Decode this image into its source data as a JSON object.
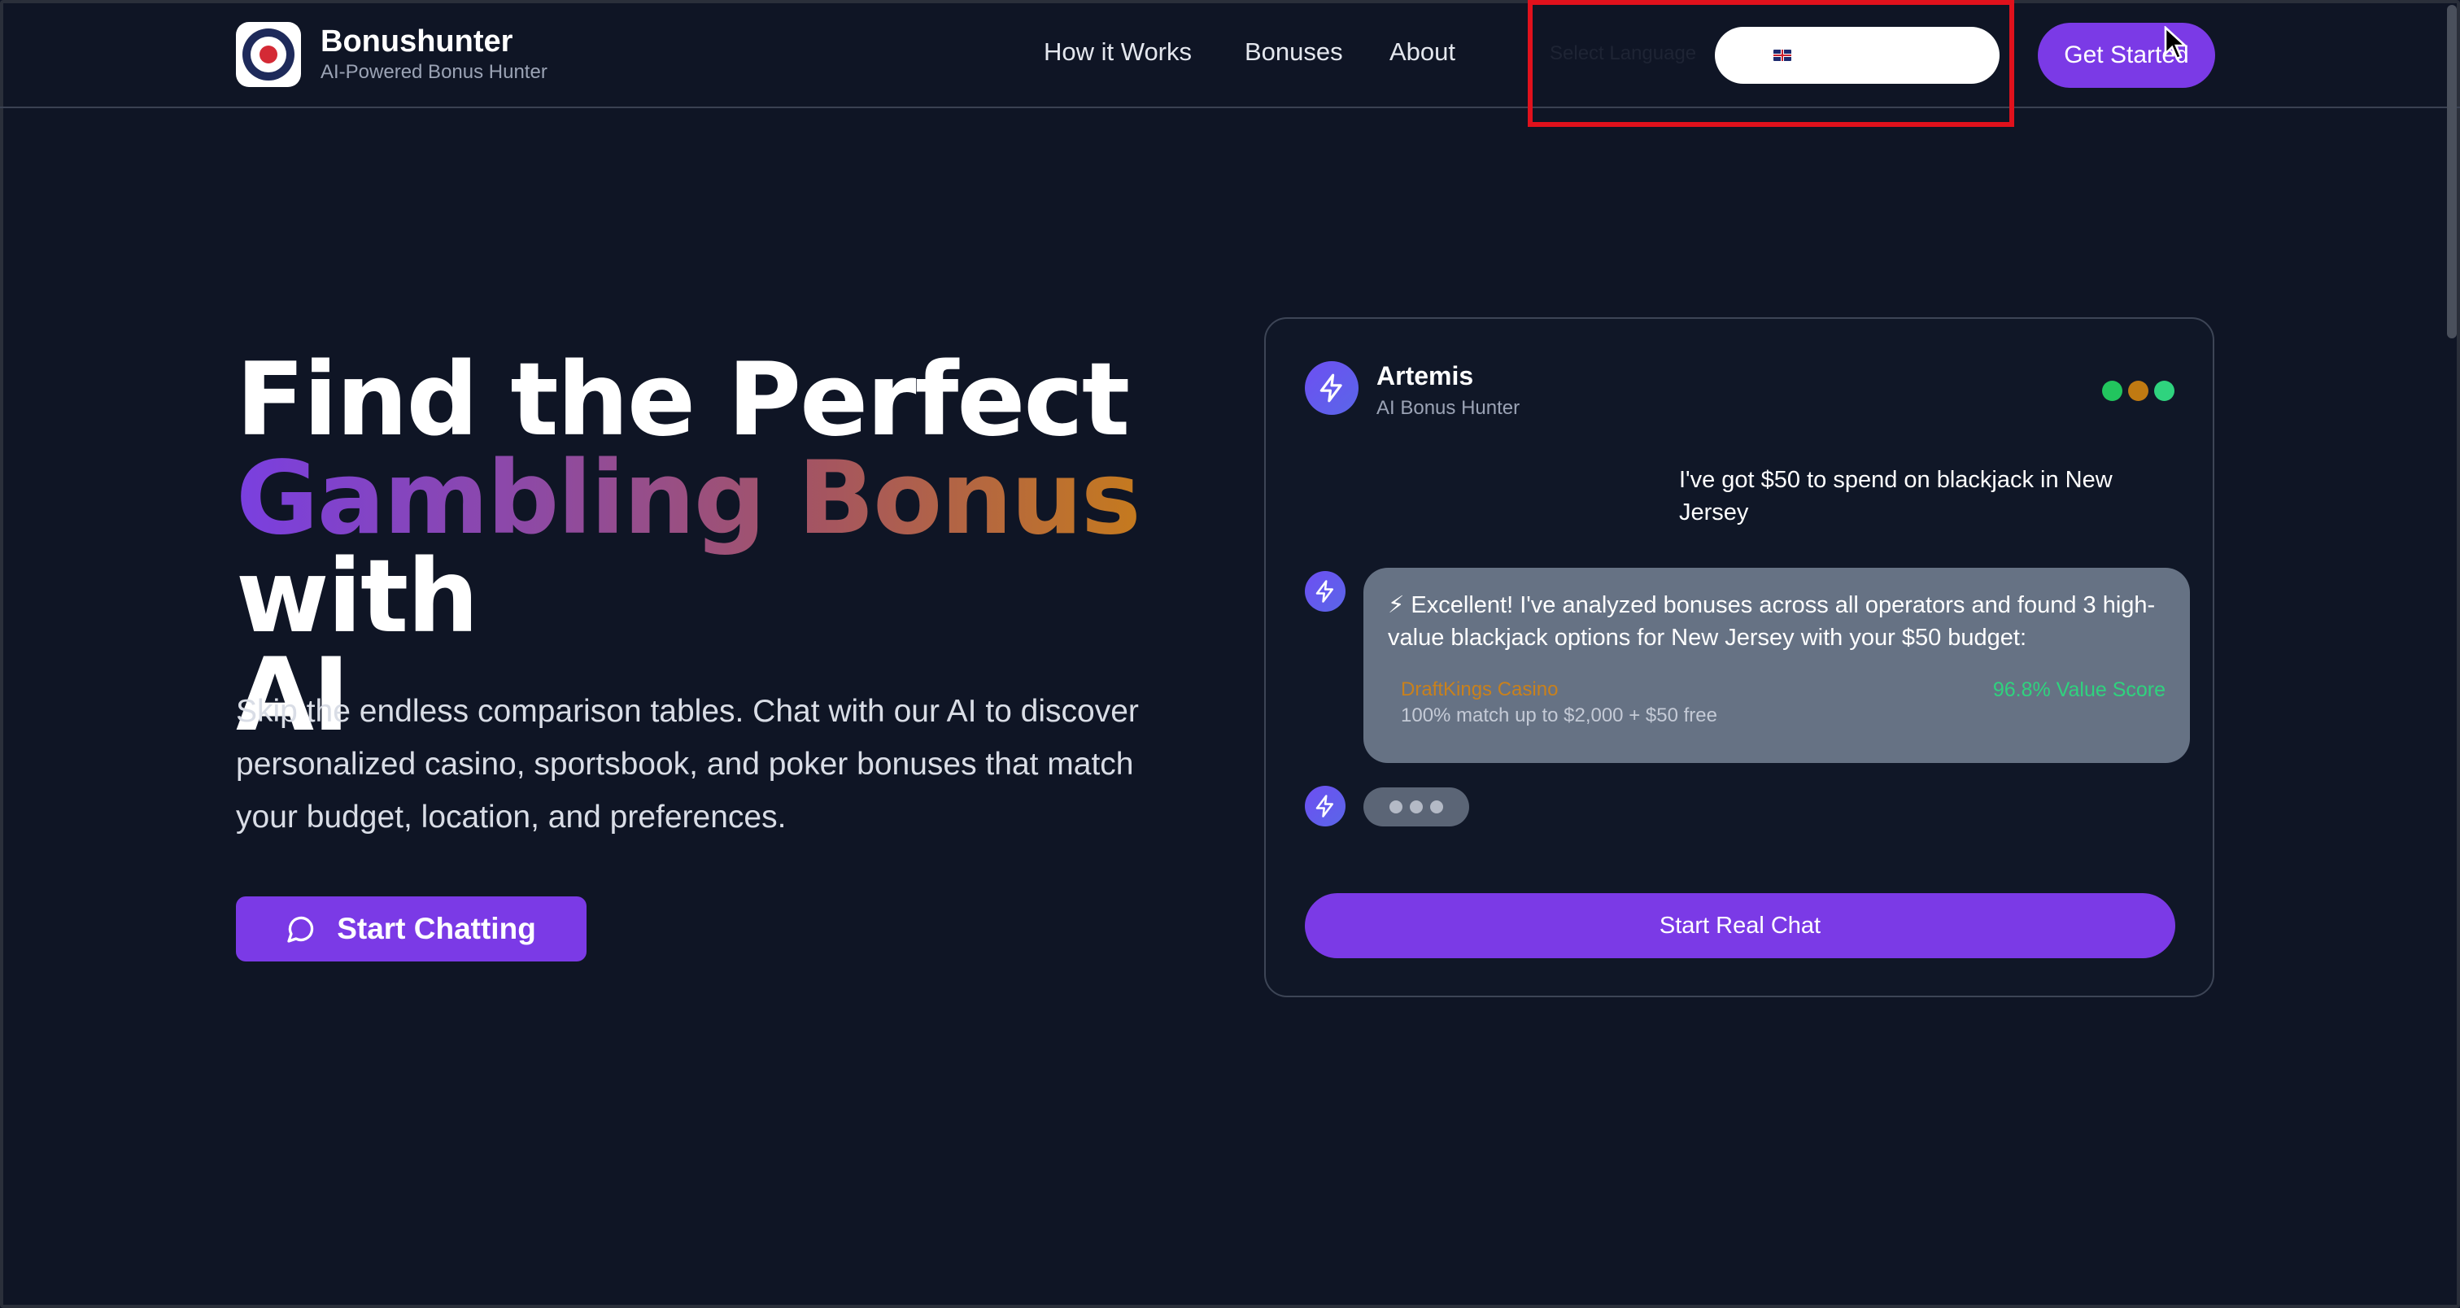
{
  "brand": {
    "name": "Bonushunter",
    "tagline": "AI-Powered Bonus Hunter"
  },
  "nav": {
    "items": [
      "How it Works",
      "Bonuses",
      "About"
    ]
  },
  "language": {
    "hint_text": "Select Language",
    "selected_flag": "uk-flag-icon"
  },
  "header": {
    "cta_label": "Get Started"
  },
  "hero": {
    "title_line1": "Find the Perfect",
    "title_gradient": "Gambling Bonus",
    "title_with": "with",
    "title_line3": "AI",
    "subtitle": "Skip the endless comparison tables. Chat with our AI to discover personalized casino, sportsbook, and poker bonuses that match your budget, location, and preferences.",
    "cta_label": "Start Chatting",
    "cta_icon": "chat-bubble-icon"
  },
  "chat": {
    "bot_name": "Artemis",
    "bot_role": "AI Bonus Hunter",
    "bot_icon": "lightning-icon",
    "status_dots": [
      "#22c55e",
      "#c07a12",
      "#2fd37e"
    ],
    "user_message": "I've got $50 to spend on blackjack in New Jersey",
    "bot_message": "⚡ Excellent! I've analyzed bonuses across all operators and found 3 high-value blackjack options for New Jersey with your $50 budget:",
    "offer": {
      "name": "DraftKings Casino",
      "score": "96.8% Value Score",
      "description": "100% match up to $2,000 + $50 free"
    },
    "cta_label": "Start Real Chat"
  },
  "colors": {
    "background": "#0f1525",
    "accent": "#7b3ae6",
    "highlight": "#e0111c"
  }
}
